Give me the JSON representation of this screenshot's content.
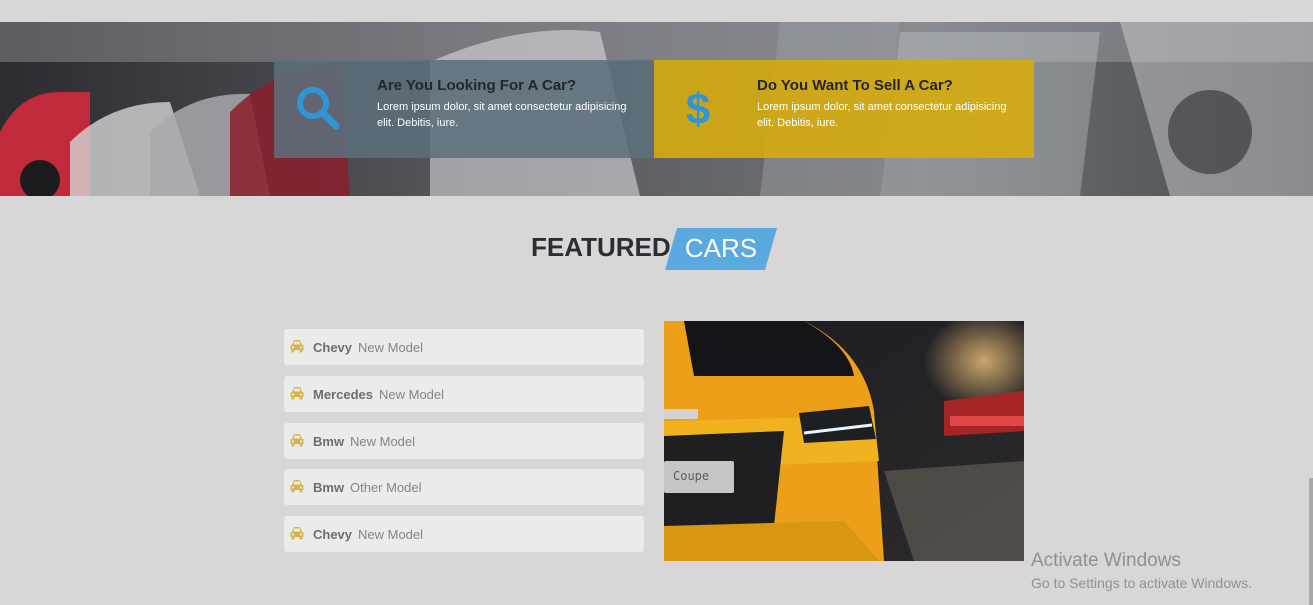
{
  "hero": {
    "buy_card": {
      "icon": "search-icon",
      "title": "Are You Looking For A Car?",
      "text": "Lorem ipsum dolor, sit amet consectetur adipisicing elit. Debitis, iure."
    },
    "sell_card": {
      "icon": "dollar-icon",
      "title": "Do You Want To Sell A Car?",
      "text": "Lorem ipsum dolor, sit amet consectetur adipisicing elit. Debitis, iure."
    }
  },
  "featured": {
    "title_part1": "FEATURED",
    "title_part2": "CARS",
    "items": [
      {
        "brand": "Chevy",
        "model": "New Model",
        "icon": "car-icon"
      },
      {
        "brand": "Mercedes",
        "model": "New Model",
        "icon": "car-icon"
      },
      {
        "brand": "Bmw",
        "model": "New Model",
        "icon": "car-icon"
      },
      {
        "brand": "Bmw",
        "model": "Other Model",
        "icon": "car-icon"
      },
      {
        "brand": "Chevy",
        "model": "New Model",
        "icon": "car-icon"
      }
    ],
    "photo_plate": "Coupe"
  },
  "watermark": {
    "title": "Activate Windows",
    "subtitle": "Go to Settings to activate Windows."
  },
  "colors": {
    "accent_blue": "#5aa9df",
    "accent_yellow": "#d6ac0e",
    "car_icon": "#d8b24a",
    "background": "#d8d6d7"
  }
}
